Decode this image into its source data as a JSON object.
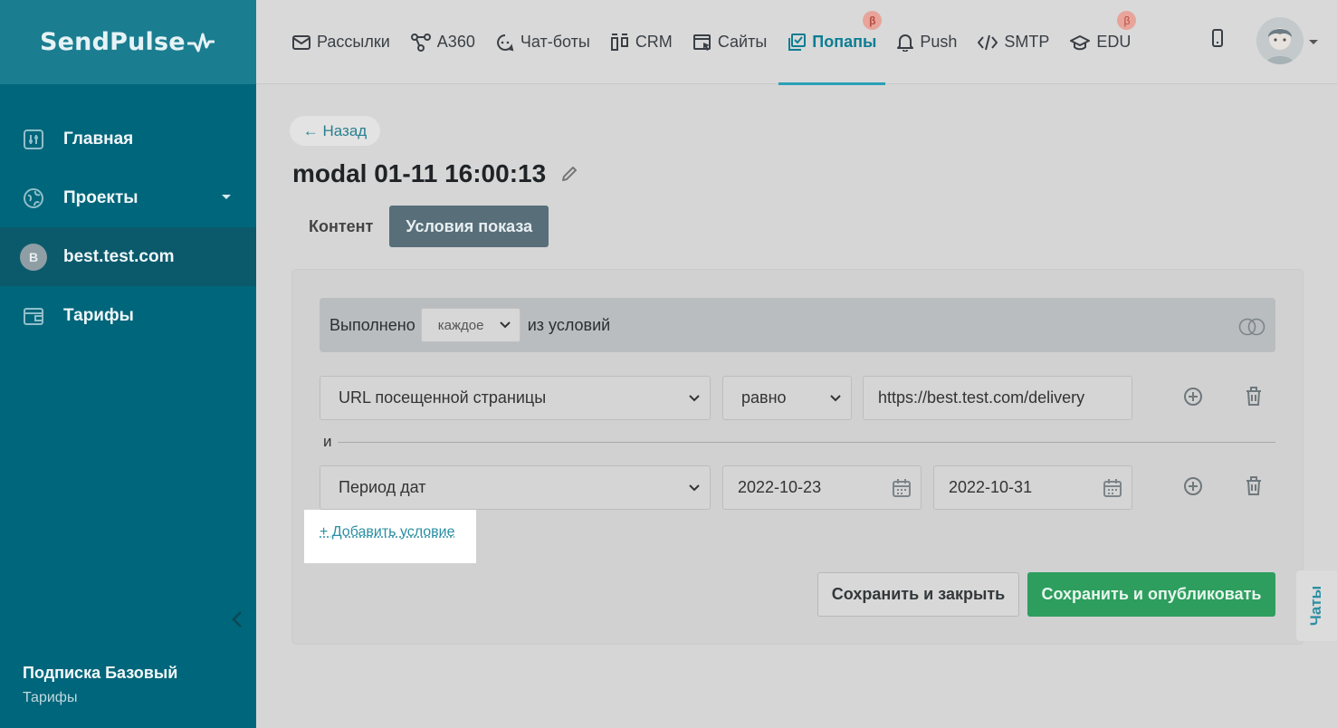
{
  "brand": {
    "name": "SendPulse"
  },
  "sidebar": {
    "items": [
      {
        "label": "Главная",
        "icon": "dashboard-icon"
      },
      {
        "label": "Проекты",
        "icon": "globe-icon"
      },
      {
        "label": "best.test.com",
        "avatar_letter": "B"
      },
      {
        "label": "Тарифы",
        "icon": "wallet-icon"
      }
    ],
    "plan_title": "Подписка Базовый",
    "plan_link": "Тарифы"
  },
  "topnav": {
    "items": [
      {
        "label": "Рассылки",
        "icon": "mail-icon"
      },
      {
        "label": "A360",
        "icon": "automation-icon"
      },
      {
        "label": "Чат-боты",
        "icon": "chatbot-icon"
      },
      {
        "label": "CRM",
        "icon": "crm-icon"
      },
      {
        "label": "Сайты",
        "icon": "site-icon"
      },
      {
        "label": "Попапы",
        "icon": "popup-icon",
        "active": true,
        "beta": "β"
      },
      {
        "label": "Push",
        "icon": "bell-icon"
      },
      {
        "label": "SMTP",
        "icon": "code-icon"
      },
      {
        "label": "EDU",
        "icon": "graduation-cap-icon",
        "beta": "β"
      }
    ]
  },
  "main": {
    "back_label": "← Назад",
    "title": "modal 01-11 16:00:13",
    "tabs": [
      {
        "label": "Контент"
      },
      {
        "label": "Условия показа",
        "active": true
      }
    ],
    "condition_header": {
      "prefix": "Выполнено",
      "select_value": "каждое",
      "suffix": "из условий"
    },
    "row1": {
      "field": "URL посещенной страницы",
      "operator": "равно",
      "value": "https://best.test.com/delivery"
    },
    "and_label": "и",
    "row2": {
      "field": "Период дат",
      "date_from": "2022-10-23",
      "date_to": "2022-10-31"
    },
    "add_condition": "+ Добавить условие",
    "save_close": "Сохранить и закрыть",
    "save_publish": "Сохранить и опубликовать"
  },
  "chats_label": "Чаты",
  "colors": {
    "sidebar": "#00667b",
    "accent": "#0d7d93",
    "primary_button": "#2d9e5e",
    "active_tab": "#586f7a"
  }
}
